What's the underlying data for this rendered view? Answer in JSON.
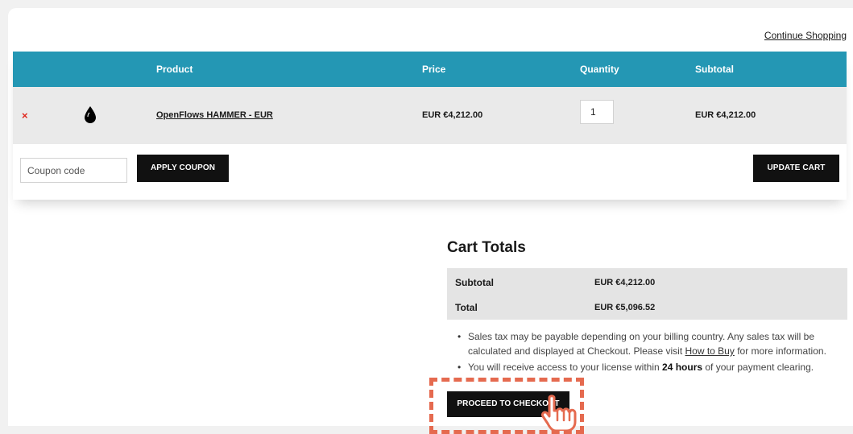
{
  "header": {
    "continue_label": "Continue Shopping"
  },
  "table": {
    "columns": [
      "Product",
      "Price",
      "Quantity",
      "Subtotal"
    ],
    "row": {
      "remove_glyph": "×",
      "product_icon": "drop-icon",
      "product_name": "OpenFlows HAMMER - EUR",
      "price": "EUR €4,212.00",
      "quantity": "1",
      "subtotal": "EUR €4,212.00"
    }
  },
  "actions": {
    "coupon_placeholder": "Coupon code",
    "apply_label": "APPLY COUPON",
    "update_label": "UPDATE CART"
  },
  "totals": {
    "title": "Cart Totals",
    "subtotal_label": "Subtotal",
    "subtotal_value": "EUR €4,212.00",
    "total_label": "Total",
    "total_value": "EUR €5,096.52"
  },
  "notes": {
    "tax_pre": "Sales tax may be payable depending on your billing country. Any sales tax will be calculated and displayed at Checkout. Please visit ",
    "tax_link": "How to Buy",
    "tax_post": " for more information.",
    "access_pre": "You will receive access to your license within ",
    "access_bold": "24 hours",
    "access_post": " of your payment clearing."
  },
  "checkout_label": "PROCEED TO CHECKOUT",
  "colors": {
    "header_bg": "#2497b4",
    "remove": "#e0261c",
    "highlight": "#e56a4f",
    "button": "#111111"
  }
}
